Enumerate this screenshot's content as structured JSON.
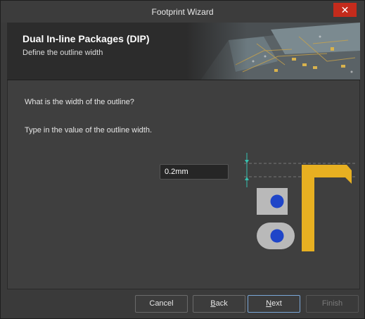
{
  "window": {
    "title": "Footprint Wizard",
    "close_glyph": "✕"
  },
  "header": {
    "title": "Dual In-line Packages (DIP)",
    "subtitle": "Define the outline width"
  },
  "body": {
    "question": "What is the width of the outline?",
    "hint": "Type in the value of the outline width.",
    "width_value": "0.2mm"
  },
  "buttons": {
    "cancel": "Cancel",
    "back_rest": "ack",
    "back_key": "B",
    "next_rest": "ext",
    "next_key": "N",
    "finish": "Finish"
  },
  "colors": {
    "outline": "#e8b021",
    "pad": "#b9b9b9",
    "hole": "#1f45c8",
    "dimension": "#36c2b0",
    "close": "#c42b1c"
  }
}
